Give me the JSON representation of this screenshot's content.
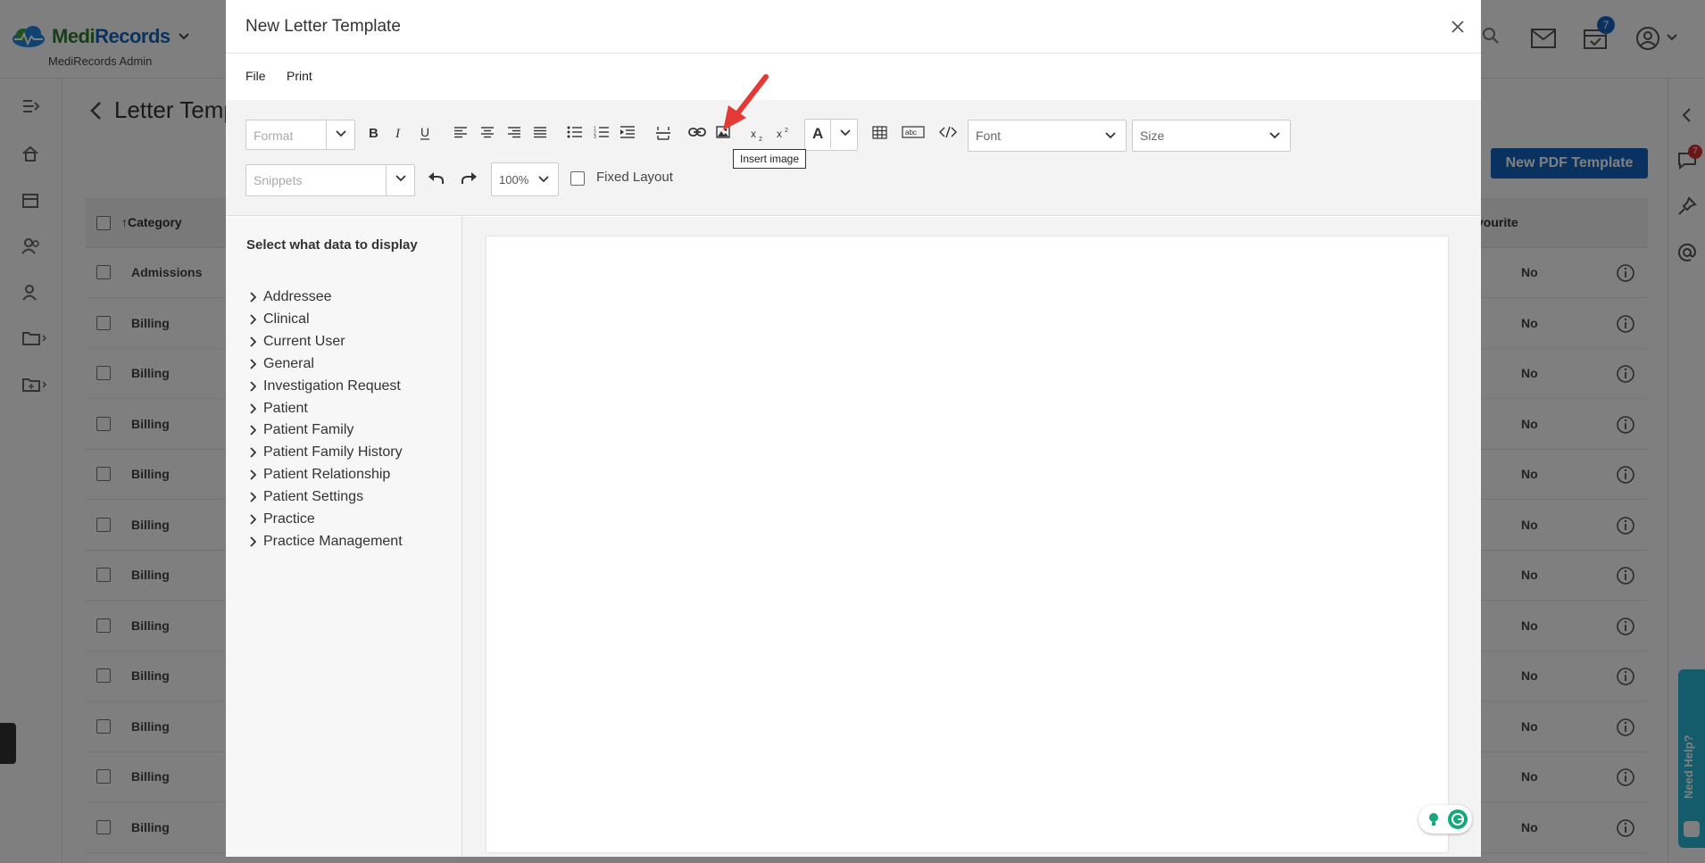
{
  "app": {
    "brand_part1": "Medi",
    "brand_part2": "Records",
    "user_role": "MediRecords Admin",
    "calendar_badge": "7",
    "chat_badge": "7",
    "page_title": "Letter Temp",
    "new_pdf_button": "New PDF Template",
    "need_help": "Need Help?",
    "table": {
      "col_category": "Category",
      "col_favourite": "vourite",
      "rows": [
        {
          "category": "Admissions",
          "favourite": "No"
        },
        {
          "category": "Billing",
          "favourite": "No"
        },
        {
          "category": "Billing",
          "favourite": "No"
        },
        {
          "category": "Billing",
          "favourite": "No"
        },
        {
          "category": "Billing",
          "favourite": "No"
        },
        {
          "category": "Billing",
          "favourite": "No"
        },
        {
          "category": "Billing",
          "favourite": "No"
        },
        {
          "category": "Billing",
          "favourite": "No"
        },
        {
          "category": "Billing",
          "favourite": "No"
        },
        {
          "category": "Billing",
          "favourite": "No"
        },
        {
          "category": "Billing",
          "favourite": "No"
        },
        {
          "category": "Billing",
          "favourite": "No"
        }
      ]
    }
  },
  "modal": {
    "title": "New Letter Template",
    "menu": {
      "file": "File",
      "print": "Print"
    },
    "toolbar": {
      "format_placeholder": "Format",
      "snippets_placeholder": "Snippets",
      "zoom_value": "100%",
      "font_placeholder": "Font",
      "size_placeholder": "Size",
      "fixed_layout_label": "Fixed Layout",
      "font_color_letter": "A",
      "tooltip": "Insert image"
    },
    "data_panel": {
      "heading": "Select what data to display",
      "items": [
        "Addressee",
        "Clinical",
        "Current User",
        "General",
        "Investigation Request",
        "Patient",
        "Patient Family",
        "Patient Family History",
        "Patient Relationship",
        "Patient Settings",
        "Practice",
        "Practice Management"
      ]
    }
  },
  "colors": {
    "primary": "#1565c0",
    "brand_green": "#2e7d32",
    "help_blue": "#29b6d6",
    "annotation_red": "#e53935",
    "grammarly_green": "#15a87b"
  }
}
